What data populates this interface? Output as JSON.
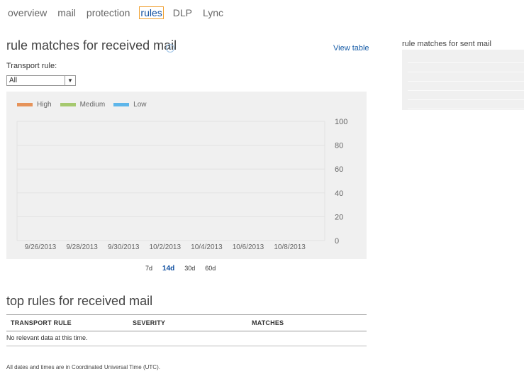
{
  "nav": {
    "tabs": [
      {
        "label": "overview",
        "active": false
      },
      {
        "label": "mail",
        "active": false
      },
      {
        "label": "protection",
        "active": false
      },
      {
        "label": "rules",
        "active": true
      },
      {
        "label": "DLP",
        "active": false
      },
      {
        "label": "Lync",
        "active": false
      }
    ]
  },
  "received": {
    "title": "rule matches for received mail",
    "info_icon": "info-icon",
    "view_table": "View table",
    "transport_label": "Transport rule:",
    "transport_value": "All"
  },
  "chart_data": {
    "type": "line",
    "title": "",
    "legend": [
      "High",
      "Medium",
      "Low"
    ],
    "legend_position": "top-left",
    "colors": {
      "High": "#e6935a",
      "Medium": "#a6c96f",
      "Low": "#5eb6ea"
    },
    "x": [
      "9/26/2013",
      "9/28/2013",
      "9/30/2013",
      "10/2/2013",
      "10/4/2013",
      "10/6/2013",
      "10/8/2013"
    ],
    "yticks": [
      "100",
      "80",
      "60",
      "40",
      "20",
      "0"
    ],
    "ylim": [
      0,
      100
    ],
    "grid": true,
    "series": [
      {
        "name": "High",
        "values": []
      },
      {
        "name": "Medium",
        "values": []
      },
      {
        "name": "Low",
        "values": []
      }
    ]
  },
  "ranges": {
    "items": [
      {
        "label": "7d",
        "selected": false
      },
      {
        "label": "14d",
        "selected": true
      },
      {
        "label": "30d",
        "selected": false
      },
      {
        "label": "60d",
        "selected": false
      }
    ]
  },
  "top_rules": {
    "title": "top rules for received mail",
    "columns": [
      "TRANSPORT RULE",
      "SEVERITY",
      "MATCHES"
    ],
    "empty_message": "No relevant data at this time."
  },
  "footnote": "All dates and times are in Coordinated Universal Time (UTC).",
  "sent": {
    "title": "rule matches for sent mail"
  }
}
